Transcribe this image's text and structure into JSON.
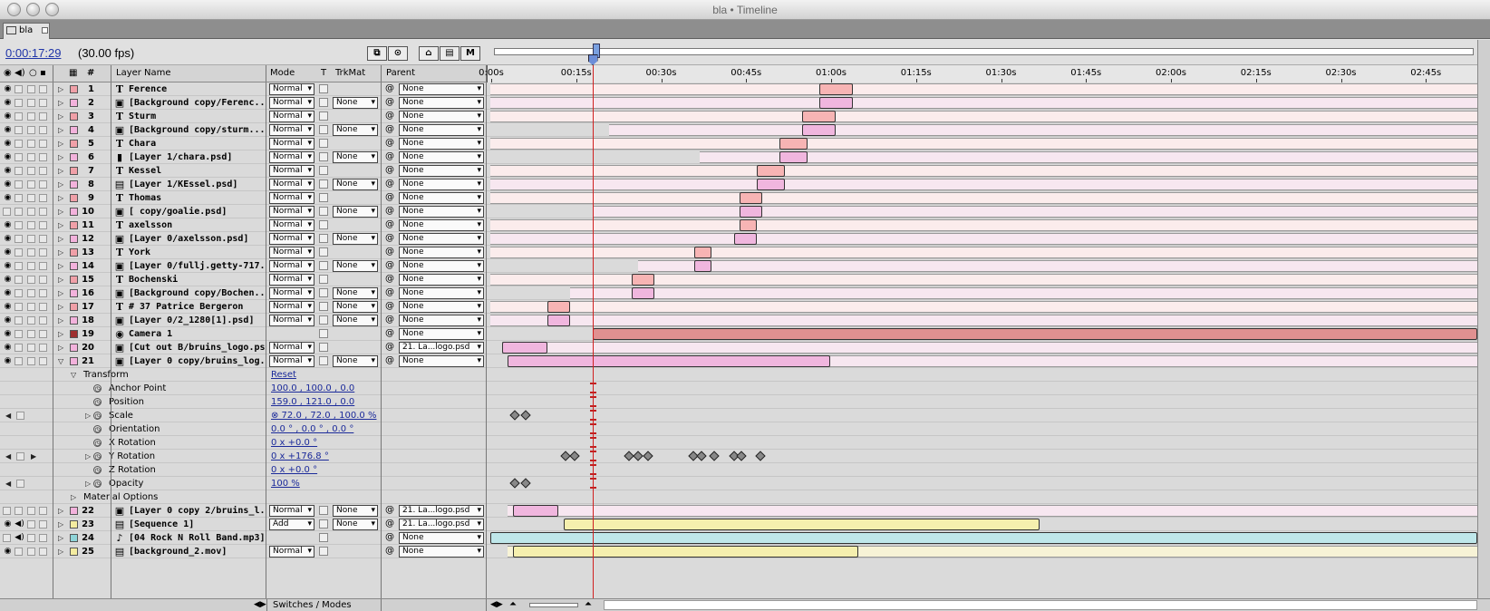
{
  "window": {
    "title": "bla • Timeline"
  },
  "tab": {
    "label": "bla"
  },
  "toolbar": {
    "timecode": "0:00:17:29",
    "fps": "(30.00 fps)"
  },
  "columns": {
    "num": "#",
    "layer_name": "Layer Name",
    "mode": "Mode",
    "t": "T",
    "trkmat": "TrkMat",
    "parent": "Parent"
  },
  "ruler_ticks": [
    "0:00s",
    "00:15s",
    "00:30s",
    "00:45s",
    "01:00s",
    "01:15s",
    "01:30s",
    "01:45s",
    "02:00s",
    "02:15s",
    "02:30s",
    "02:45s"
  ],
  "current_time_seconds": 18,
  "layers": [
    {
      "num": "1",
      "icon": "T",
      "name": "Ference",
      "label_color": "#f0a0a8",
      "mode": "Normal",
      "trkmat": "",
      "parent": "None",
      "bar": [
        0,
        175
      ],
      "work": [
        58,
        64
      ],
      "bar_color": "#fbecec",
      "work_color": "#f7b4b4"
    },
    {
      "num": "2",
      "icon": "▣",
      "name": "[Background copy/Ferenc...",
      "label_color": "#f3b2dc",
      "mode": "Normal",
      "trkmat": "None",
      "parent": "None",
      "bar": [
        0,
        175
      ],
      "work": [
        58,
        64
      ],
      "bar_color": "#f7e7f0",
      "work_color": "#f0b6de"
    },
    {
      "num": "3",
      "icon": "T",
      "name": "Sturm",
      "label_color": "#f0a0a8",
      "mode": "Normal",
      "trkmat": "",
      "parent": "None",
      "bar": [
        0,
        175
      ],
      "work": [
        55,
        61
      ],
      "bar_color": "#fbecec",
      "work_color": "#f7b4b4"
    },
    {
      "num": "4",
      "icon": "▣",
      "name": "[Background copy/sturm...",
      "label_color": "#f3b2dc",
      "mode": "Normal",
      "trkmat": "None",
      "parent": "None",
      "bar": [
        21,
        175
      ],
      "work": [
        55,
        61
      ],
      "bar_color": "#f7e7f0",
      "work_color": "#f0b6de"
    },
    {
      "num": "5",
      "icon": "T",
      "name": "Chara",
      "label_color": "#f0a0a8",
      "mode": "Normal",
      "trkmat": "",
      "parent": "None",
      "bar": [
        0,
        175
      ],
      "work": [
        51,
        56
      ],
      "bar_color": "#fbecec",
      "work_color": "#f7b4b4"
    },
    {
      "num": "6",
      "icon": "▮",
      "name": "[Layer 1/chara.psd]",
      "label_color": "#f3b2dc",
      "mode": "Normal",
      "trkmat": "None",
      "parent": "None",
      "bar": [
        37,
        175
      ],
      "work": [
        51,
        56
      ],
      "bar_color": "#f7e7f0",
      "work_color": "#f0b6de"
    },
    {
      "num": "7",
      "icon": "T",
      "name": "Kessel",
      "label_color": "#f0a0a8",
      "mode": "Normal",
      "trkmat": "",
      "parent": "None",
      "bar": [
        0,
        175
      ],
      "work": [
        47,
        52
      ],
      "bar_color": "#fbecec",
      "work_color": "#f7b4b4"
    },
    {
      "num": "8",
      "icon": "▤",
      "name": "[Layer 1/KEssel.psd]",
      "label_color": "#f3b2dc",
      "mode": "Normal",
      "trkmat": "None",
      "parent": "None",
      "bar": [
        0,
        175
      ],
      "work": [
        47,
        52
      ],
      "bar_color": "#f7e7f0",
      "work_color": "#f0b6de"
    },
    {
      "num": "9",
      "icon": "T",
      "name": "Thomas",
      "label_color": "#f0a0a8",
      "mode": "Normal",
      "trkmat": "",
      "parent": "None",
      "bar": [
        0,
        175
      ],
      "work": [
        44,
        48
      ],
      "bar_color": "#fbecec",
      "work_color": "#f7b4b4"
    },
    {
      "num": "10",
      "icon": "▣",
      "name": "[ copy/goalie.psd]",
      "label_color": "#f3b2dc",
      "mode": "Normal",
      "trkmat": "None",
      "parent": "None",
      "bar": [
        18,
        175
      ],
      "work": [
        44,
        48
      ],
      "bar_color": "#f7e7f0",
      "work_color": "#f0b6de"
    },
    {
      "num": "11",
      "icon": "T",
      "name": "axelsson",
      "label_color": "#f0a0a8",
      "mode": "Normal",
      "trkmat": "",
      "parent": "None",
      "bar": [
        0,
        175
      ],
      "work": [
        44,
        47
      ],
      "bar_color": "#fbecec",
      "work_color": "#f7b4b4"
    },
    {
      "num": "12",
      "icon": "▣",
      "name": "[Layer 0/axelsson.psd]",
      "label_color": "#f3b2dc",
      "mode": "Normal",
      "trkmat": "None",
      "parent": "None",
      "bar": [
        0,
        175
      ],
      "work": [
        43,
        47
      ],
      "bar_color": "#f7e7f0",
      "work_color": "#f0b6de"
    },
    {
      "num": "13",
      "icon": "T",
      "name": "York",
      "label_color": "#f0a0a8",
      "mode": "Normal",
      "trkmat": "",
      "parent": "None",
      "bar": [
        0,
        175
      ],
      "work": [
        36,
        39
      ],
      "bar_color": "#fbecec",
      "work_color": "#f7b4b4"
    },
    {
      "num": "14",
      "icon": "▣",
      "name": "[Layer 0/fullj.getty-717...",
      "label_color": "#f3b2dc",
      "mode": "Normal",
      "trkmat": "None",
      "parent": "None",
      "bar": [
        26,
        175
      ],
      "work": [
        36,
        39
      ],
      "bar_color": "#f7e7f0",
      "work_color": "#f0b6de"
    },
    {
      "num": "15",
      "icon": "T",
      "name": "Bochenski",
      "label_color": "#f0a0a8",
      "mode": "Normal",
      "trkmat": "",
      "parent": "None",
      "bar": [
        0,
        175
      ],
      "work": [
        25,
        29
      ],
      "bar_color": "#fbecec",
      "work_color": "#f7b4b4"
    },
    {
      "num": "16",
      "icon": "▣",
      "name": "[Background copy/Bochen...",
      "label_color": "#f3b2dc",
      "mode": "Normal",
      "trkmat": "None",
      "parent": "None",
      "bar": [
        14,
        175
      ],
      "work": [
        25,
        29
      ],
      "bar_color": "#f7e7f0",
      "work_color": "#f0b6de"
    },
    {
      "num": "17",
      "icon": "T",
      "name": "# 37 Patrice Bergeron",
      "label_color": "#f0a0a8",
      "mode": "Normal",
      "trkmat": "None",
      "parent": "None",
      "bar": [
        0,
        175
      ],
      "work": [
        10,
        14
      ],
      "bar_color": "#fbecec",
      "work_color": "#f7b4b4"
    },
    {
      "num": "18",
      "icon": "▣",
      "name": "[Layer 0/2_1280[1].psd]",
      "label_color": "#f3b2dc",
      "mode": "Normal",
      "trkmat": "None",
      "parent": "None",
      "bar": [
        0,
        175
      ],
      "work": [
        10,
        14
      ],
      "bar_color": "#f7e7f0",
      "work_color": "#f0b6de"
    },
    {
      "num": "19",
      "icon": "◉",
      "name": "Camera 1",
      "label_color": "#9e2e2e",
      "mode": "",
      "trkmat": "",
      "parent": "None",
      "bar": [
        0,
        0
      ],
      "work": [
        18,
        175
      ],
      "bar_color": "#f0d6d6",
      "work_color": "#e09090"
    },
    {
      "num": "20",
      "icon": "▣",
      "name": "[Cut out B/bruins_logo.ps...",
      "label_color": "#f3b2dc",
      "mode": "Normal",
      "trkmat": "",
      "parent": "21. La...logo.psd",
      "bar": [
        2,
        175
      ],
      "work": [
        2,
        10
      ],
      "bar_color": "#f7e7f0",
      "work_color": "#f0b6de"
    },
    {
      "num": "21",
      "icon": "▣",
      "name": "[Layer 0 copy/bruins_log...",
      "label_color": "#f3b2dc",
      "mode": "Normal",
      "trkmat": "None",
      "parent": "None",
      "bar": [
        3,
        175
      ],
      "work": [
        3,
        60
      ],
      "bar_color": "#f7e7f0",
      "work_color": "#f0b6de"
    },
    {
      "num": "22",
      "icon": "▣",
      "name": "[Layer 0 copy 2/bruins_l...",
      "label_color": "#f3b2dc",
      "mode": "Normal",
      "trkmat": "None",
      "parent": "21. La...logo.psd",
      "bar": [
        3,
        175
      ],
      "work": [
        4,
        12
      ],
      "bar_color": "#f7e7f0",
      "work_color": "#f0b6de"
    },
    {
      "num": "23",
      "icon": "▤",
      "name": "[Sequence 1]",
      "label_color": "#f4eca0",
      "mode": "Add",
      "trkmat": "None",
      "parent": "21. La...logo.psd",
      "bar": [
        0,
        0
      ],
      "work": [
        13,
        97
      ],
      "bar_color": "#f7f3d6",
      "work_color": "#f5efae"
    },
    {
      "num": "24",
      "icon": "♪",
      "name": "[04 Rock N Roll Band.mp3]",
      "label_color": "#8ed4d8",
      "mode": "",
      "trkmat": "",
      "parent": "None",
      "bar": [
        0,
        0
      ],
      "work": [
        0,
        175
      ],
      "bar_color": "#c8ecee",
      "work_color": "#bfe7ea"
    },
    {
      "num": "25",
      "icon": "▤",
      "name": "[background_2.mov]",
      "label_color": "#f4eca0",
      "mode": "Normal",
      "trkmat": "",
      "parent": "None",
      "bar": [
        3,
        175
      ],
      "work": [
        4,
        65
      ],
      "bar_color": "#f7f3d6",
      "work_color": "#f5efae"
    }
  ],
  "transform": {
    "group_label": "Transform",
    "reset_label": "Reset",
    "material_label": "Material Options",
    "properties": [
      {
        "name": "Anchor Point",
        "value": "100.0 , 100.0 , 0.0",
        "keyframes": []
      },
      {
        "name": "Position",
        "value": "159.0 , 121.0 , 0.0",
        "keyframes": []
      },
      {
        "name": "Scale",
        "value": "⊗ 72.0 , 72.0 , 100.0 %",
        "keyframes": [
          4.3,
          6.3
        ]
      },
      {
        "name": "Orientation",
        "value": "0.0 ° , 0.0 ° , 0.0 °",
        "keyframes": []
      },
      {
        "name": "X Rotation",
        "value": "0 x +0.0 °",
        "keyframes": []
      },
      {
        "name": "Y Rotation",
        "value": "0 x +176.8 °",
        "keyframes": [
          13.3,
          14.8,
          24.5,
          26,
          27.8,
          35.8,
          37.3,
          39.5,
          43,
          44.3,
          47.6
        ]
      },
      {
        "name": "Z Rotation",
        "value": "0 x +0.0 °",
        "keyframes": []
      },
      {
        "name": "Opacity",
        "value": "100 %",
        "keyframes": [
          4.3,
          6.3
        ]
      }
    ]
  },
  "status": {
    "switches_modes": "Switches / Modes"
  }
}
